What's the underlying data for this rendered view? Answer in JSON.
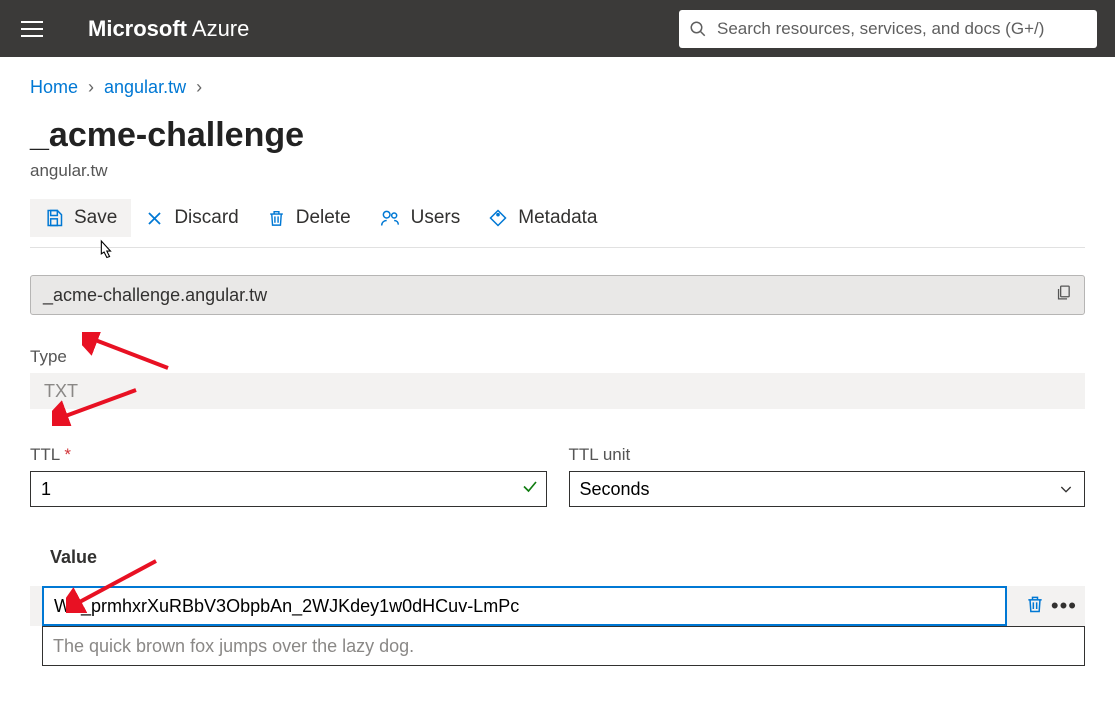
{
  "topbar": {
    "brand_prefix": "Microsoft",
    "brand_suffix": " Azure",
    "search_placeholder": "Search resources, services, and docs (G+/)"
  },
  "breadcrumb": {
    "home": "Home",
    "parent": "angular.tw"
  },
  "page": {
    "title": "_acme-challenge",
    "subtitle": "angular.tw"
  },
  "toolbar": {
    "save": "Save",
    "discard": "Discard",
    "delete": "Delete",
    "users": "Users",
    "metadata": "Metadata"
  },
  "name_field": "_acme-challenge.angular.tw",
  "type": {
    "label": "Type",
    "value": "TXT"
  },
  "ttl": {
    "label": "TTL",
    "value": "1"
  },
  "ttl_unit": {
    "label": "TTL unit",
    "value": "Seconds"
  },
  "value_section": {
    "label": "Value",
    "rows": [
      "WL_prmhxrXuRBbV3ObpbAn_2WJKdey1w0dHCuv-LmPc",
      "The quick brown fox jumps over the lazy dog."
    ]
  }
}
